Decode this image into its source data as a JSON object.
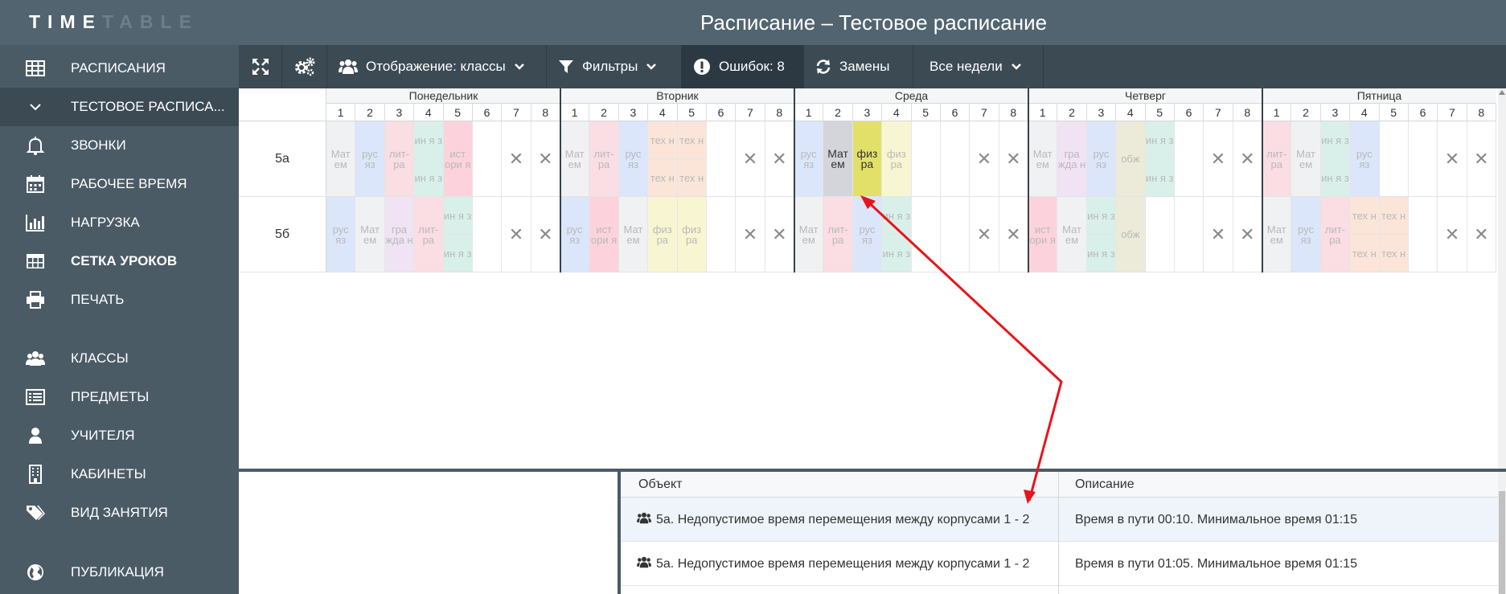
{
  "app": {
    "logo_bright": "TIME",
    "logo_dim": "TABLE",
    "title": "Расписание – Тестовое расписание"
  },
  "sidebar": {
    "items": [
      {
        "label": "РАСПИСАНИЯ",
        "icon": "grid-icon"
      },
      {
        "label": "ТЕСТОВОЕ РАСПИСА...",
        "icon": "chevron-down-icon",
        "active": true
      },
      {
        "label": "ЗВОНКИ",
        "icon": "bell-icon"
      },
      {
        "label": "РАБОЧЕЕ ВРЕМЯ",
        "icon": "calendar-icon"
      },
      {
        "label": "НАГРУЗКА",
        "icon": "bar-chart-icon"
      },
      {
        "label": "СЕТКА УРОКОВ",
        "icon": "table-icon",
        "current": true
      },
      {
        "label": "ПЕЧАТЬ",
        "icon": "printer-icon"
      },
      {
        "label": "КЛАССЫ",
        "icon": "users-icon"
      },
      {
        "label": "ПРЕДМЕТЫ",
        "icon": "list-icon"
      },
      {
        "label": "УЧИТЕЛЯ",
        "icon": "user-icon"
      },
      {
        "label": "КАБИНЕТЫ",
        "icon": "building-icon"
      },
      {
        "label": "ВИД ЗАНЯТИЯ",
        "icon": "tags-icon"
      },
      {
        "label": "ПУБЛИКАЦИЯ",
        "icon": "globe-icon"
      }
    ]
  },
  "toolbar": {
    "display_label": "Отображение: классы",
    "filters_label": "Фильтры",
    "errors_label": "Ошибок: 8",
    "replacements_label": "Замены",
    "weeks_label": "Все недели"
  },
  "grid": {
    "days": [
      "Понедельник",
      "Вторник",
      "Среда",
      "Четверг",
      "Пятница"
    ],
    "lesson_numbers": [
      "1",
      "2",
      "3",
      "4",
      "5",
      "6",
      "7",
      "8"
    ],
    "classes": [
      "5а",
      "5б"
    ],
    "colors": {
      "matem": "#f0f1f3",
      "rus": "#dbe6fa",
      "lit": "#fbdde4",
      "inyaz": "#d9f0ea",
      "ist": "#fcd3dc",
      "tekh": "#fbe5d9",
      "fiz": "#f8f6d2",
      "grazhd": "#f0e3f3",
      "obzh": "#ecebd9",
      "matem_sel": "#d3d5db",
      "fiz_sel": "#e3e06a"
    },
    "rows": [
      {
        "class": "5а",
        "days": [
          [
            {
              "text": "Мат ем",
              "color": "matem"
            },
            {
              "text": "рус яз",
              "color": "rus"
            },
            {
              "text": "лит- ра",
              "color": "lit"
            },
            {
              "split": [
                {
                  "text": "ин я з",
                  "color": "inyaz"
                },
                {
                  "text": "ин я з",
                  "color": "inyaz"
                }
              ]
            },
            {
              "text": "ист ори я",
              "color": "ist"
            },
            {},
            {
              "x": true
            },
            {
              "x": true
            }
          ],
          [
            {
              "text": "Мат ем",
              "color": "matem"
            },
            {
              "text": "лит- ра",
              "color": "lit"
            },
            {
              "text": "рус яз",
              "color": "rus"
            },
            {
              "split": [
                {
                  "text": "тех н",
                  "color": "tekh"
                },
                {
                  "text": "тех н",
                  "color": "tekh"
                }
              ]
            },
            {
              "split": [
                {
                  "text": "тех н",
                  "color": "tekh"
                },
                {
                  "text": "тех н",
                  "color": "tekh"
                }
              ]
            },
            {},
            {
              "x": true
            },
            {
              "x": true
            }
          ],
          [
            {
              "text": "рус яз",
              "color": "rus"
            },
            {
              "text": "Мат ем",
              "color": "matem_sel",
              "bright": true
            },
            {
              "text": "физ ра",
              "color": "fiz_sel",
              "bright": true
            },
            {
              "text": "физ ра",
              "color": "fiz"
            },
            {},
            {},
            {
              "x": true
            },
            {
              "x": true
            }
          ],
          [
            {
              "text": "Мат ем",
              "color": "matem"
            },
            {
              "text": "гра жда н",
              "color": "grazhd"
            },
            {
              "text": "рус яз",
              "color": "rus"
            },
            {
              "text": "обж",
              "color": "obzh"
            },
            {
              "split": [
                {
                  "text": "ин я з",
                  "color": "inyaz"
                },
                {
                  "text": "ин я з",
                  "color": "inyaz"
                }
              ]
            },
            {},
            {
              "x": true
            },
            {
              "x": true
            }
          ],
          [
            {
              "text": "лит- ра",
              "color": "lit"
            },
            {
              "text": "Мат ем",
              "color": "matem"
            },
            {
              "split": [
                {
                  "text": "ин я з",
                  "color": "inyaz"
                },
                {
                  "text": "ин я з",
                  "color": "inyaz"
                }
              ]
            },
            {
              "text": "рус яз",
              "color": "rus"
            },
            {},
            {},
            {
              "x": true
            },
            {
              "x": true
            }
          ]
        ]
      },
      {
        "class": "5б",
        "days": [
          [
            {
              "text": "рус яз",
              "color": "rus"
            },
            {
              "text": "Мат ем",
              "color": "matem"
            },
            {
              "text": "гра жда н",
              "color": "grazhd"
            },
            {
              "text": "лит- ра",
              "color": "lit"
            },
            {
              "split": [
                {
                  "text": "ин я з",
                  "color": "inyaz"
                },
                {
                  "text": "ин я з",
                  "color": "inyaz"
                }
              ]
            },
            {},
            {
              "x": true
            },
            {
              "x": true
            }
          ],
          [
            {
              "text": "рус яз",
              "color": "rus"
            },
            {
              "text": "ист ори я",
              "color": "ist"
            },
            {
              "text": "Мат ем",
              "color": "matem"
            },
            {
              "text": "физ ра",
              "color": "fiz"
            },
            {
              "text": "физ ра",
              "color": "fiz"
            },
            {},
            {
              "x": true
            },
            {
              "x": true
            }
          ],
          [
            {
              "text": "Мат ем",
              "color": "matem"
            },
            {
              "text": "лит- ра",
              "color": "lit"
            },
            {
              "text": "рус яз",
              "color": "rus"
            },
            {
              "split": [
                {
                  "text": "ин я з",
                  "color": "inyaz"
                },
                {
                  "text": "ин я з",
                  "color": "inyaz"
                }
              ]
            },
            {},
            {},
            {
              "x": true
            },
            {
              "x": true
            }
          ],
          [
            {
              "text": "ист ори я",
              "color": "ist"
            },
            {
              "text": "Мат ем",
              "color": "matem"
            },
            {
              "split": [
                {
                  "text": "ин я з",
                  "color": "inyaz"
                },
                {
                  "text": "ин я з",
                  "color": "inyaz"
                }
              ]
            },
            {
              "text": "обж",
              "color": "obzh"
            },
            {},
            {},
            {
              "x": true
            },
            {
              "x": true
            }
          ],
          [
            {
              "text": "Мат ем",
              "color": "matem"
            },
            {
              "text": "рус яз",
              "color": "rus"
            },
            {
              "text": "лит- ра",
              "color": "lit"
            },
            {
              "split": [
                {
                  "text": "тех н",
                  "color": "tekh"
                },
                {
                  "text": "тех н",
                  "color": "tekh"
                }
              ]
            },
            {
              "split": [
                {
                  "text": "тех н",
                  "color": "tekh"
                },
                {
                  "text": "тех н",
                  "color": "tekh"
                }
              ]
            },
            {},
            {
              "x": true
            },
            {
              "x": true
            }
          ]
        ]
      }
    ]
  },
  "errors": {
    "header_object": "Объект",
    "header_description": "Описание",
    "rows": [
      {
        "object": "5а. Недопустимое время перемещения между корпусами 1 - 2",
        "description": "Время в пути 00:10. Минимальное время 01:15",
        "selected": true
      },
      {
        "object": "5а. Недопустимое время перемещения между корпусами 1 - 2",
        "description": "Время в пути 01:05. Минимальное время 01:15"
      }
    ]
  },
  "annotation": {
    "arrow_color": "#e8141b"
  }
}
